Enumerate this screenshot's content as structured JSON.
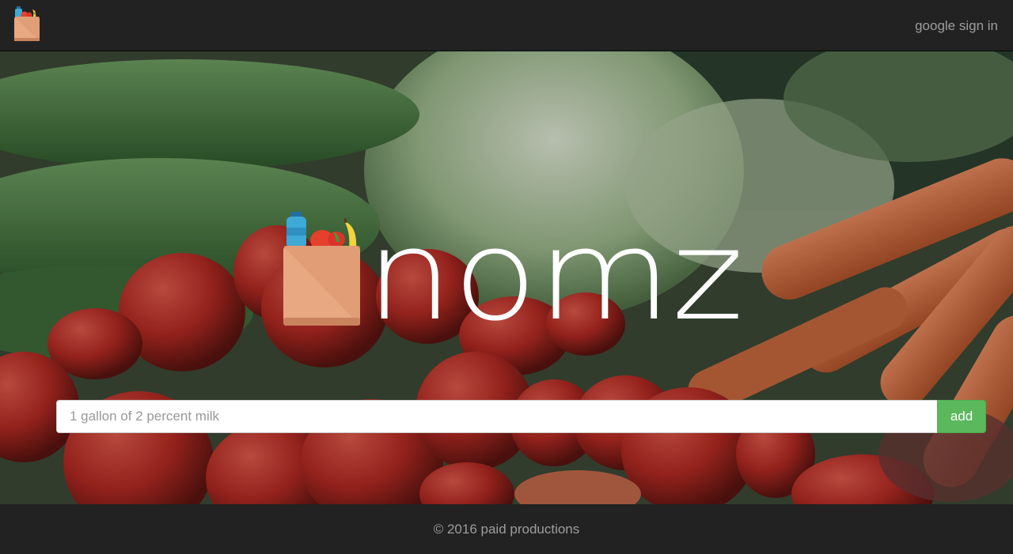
{
  "brand": {
    "icon": "grocery-bag-icon"
  },
  "nav": {
    "signin_label": "google sign in"
  },
  "hero": {
    "logo_icon": "grocery-bag-icon",
    "logo_text": "nomz",
    "background": "vegetables-photo"
  },
  "search": {
    "placeholder": "1 gallon of 2 percent milk",
    "value": ""
  },
  "actions": {
    "add_label": "add"
  },
  "footer": {
    "text": "© 2016 paid productions"
  },
  "colors": {
    "navbar": "#222222",
    "link": "#9d9d9d",
    "add_button": "#5cb85c",
    "bag": "#e8a882",
    "bag_dark": "#d8926a"
  }
}
